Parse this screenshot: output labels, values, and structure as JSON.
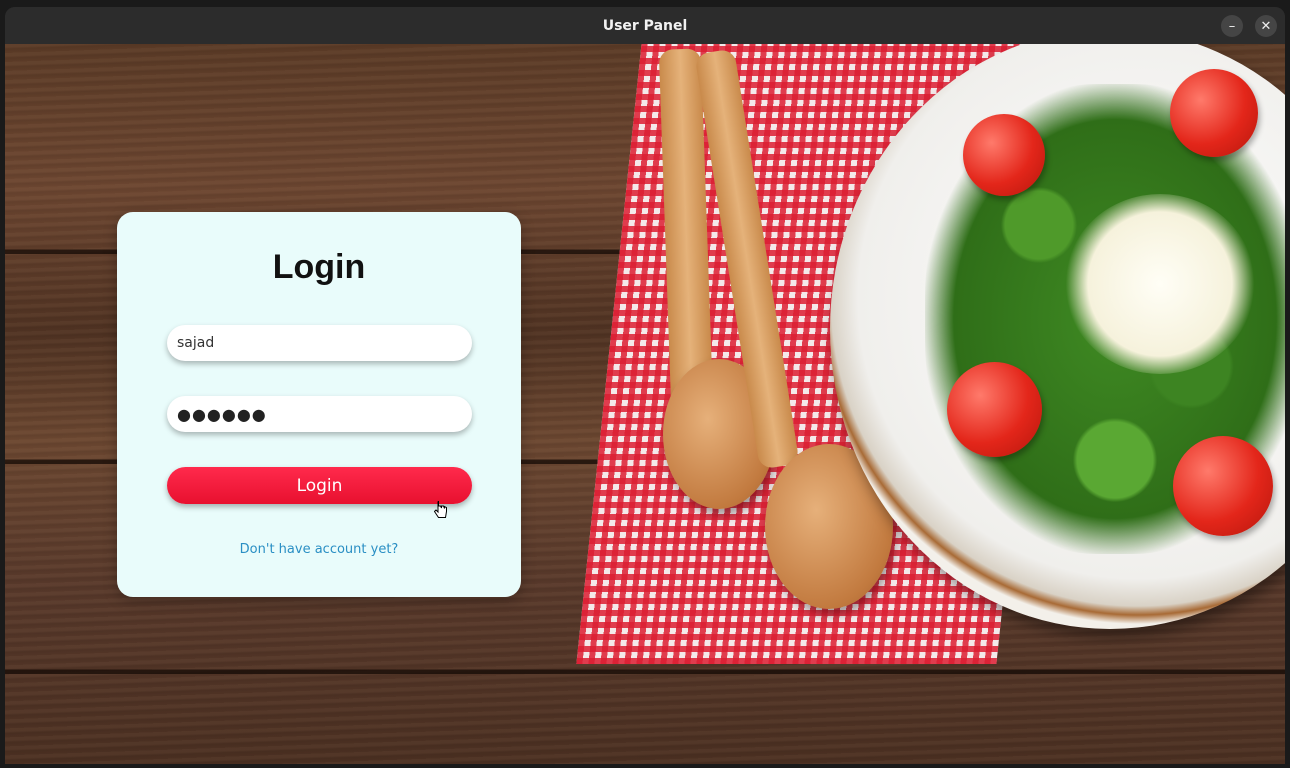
{
  "window": {
    "title": "User Panel",
    "minimize_glyph": "–",
    "close_glyph": "✕"
  },
  "login": {
    "heading": "Login",
    "username_value": "sajad",
    "password_value": "●●●●●●",
    "button_label": "Login",
    "signup_link": "Don't have account yet?"
  },
  "colors": {
    "button": "#ff1a3d",
    "card_background": "#e9fcfb",
    "link": "#2a8fc4"
  }
}
